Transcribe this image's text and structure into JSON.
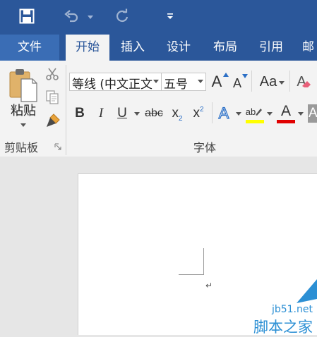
{
  "title_bar": {
    "save_icon": "save-icon",
    "undo_icon": "undo-icon",
    "redo_icon": "redo-icon",
    "customize_icon": "customize-qat-icon"
  },
  "tabs": [
    {
      "label": "文件"
    },
    {
      "label": "开始"
    },
    {
      "label": "插入"
    },
    {
      "label": "设计"
    },
    {
      "label": "布局"
    },
    {
      "label": "引用"
    },
    {
      "label": "邮"
    }
  ],
  "clipboard": {
    "paste_label": "粘贴",
    "group_label": "剪贴板"
  },
  "font": {
    "font_name": "等线 (中文正文",
    "font_size": "五号",
    "grow_label": "A",
    "shrink_label": "A",
    "case_label": "Aa",
    "bold": "B",
    "italic": "I",
    "underline": "U",
    "strike": "abc",
    "subscript_base": "x",
    "subscript_mark": "2",
    "superscript_base": "x",
    "superscript_mark": "2",
    "effects_label": "A",
    "highlight_label": "ab",
    "highlight_color": "#ffff00",
    "font_color_label": "A",
    "font_color": "#e00000",
    "shading_label": "A",
    "group_label": "字体"
  },
  "document": {
    "paragraph_mark": "↵"
  },
  "watermark": {
    "site": "jb51.net",
    "brand": "脚本之家"
  },
  "colors": {
    "accent": "#2b579a",
    "ribbon_bg": "#f3f3f3",
    "canvas_bg": "#e6e6e6"
  }
}
